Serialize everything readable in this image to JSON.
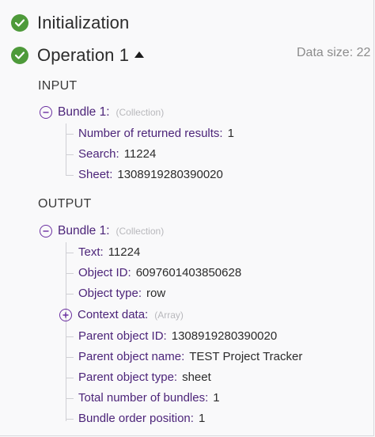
{
  "operations": [
    {
      "title": "Initialization"
    },
    {
      "title": "Operation 1",
      "data_size_label": "Data size: 22"
    }
  ],
  "input": {
    "heading": "INPUT",
    "bundle_label": "Bundle 1:",
    "bundle_type": "(Collection)",
    "fields": [
      {
        "key": "Number of returned results:",
        "value": "1"
      },
      {
        "key": "Search:",
        "value": "11224"
      },
      {
        "key": "Sheet:",
        "value": "1308919280390020"
      }
    ]
  },
  "output": {
    "heading": "OUTPUT",
    "bundle_label": "Bundle 1:",
    "bundle_type": "(Collection)",
    "fields": [
      {
        "key": "Text:",
        "value": "11224"
      },
      {
        "key": "Object ID:",
        "value": "6097601403850628"
      },
      {
        "key": "Object type:",
        "value": "row"
      },
      {
        "key": "Context data:",
        "value": "(Array)"
      },
      {
        "key": "Parent object ID:",
        "value": "1308919280390020"
      },
      {
        "key": "Parent object name:",
        "value": "TEST Project Tracker"
      },
      {
        "key": "Parent object type:",
        "value": "sheet"
      },
      {
        "key": "Total number of bundles:",
        "value": "1"
      },
      {
        "key": "Bundle order position:",
        "value": "1"
      }
    ]
  },
  "colors": {
    "check": "#4e9a3a",
    "key_text": "#4c2479",
    "toggle": "#6b2fa1",
    "muted": "#b8b8bc"
  },
  "icons": {
    "status": "check-circle-icon",
    "collapse": "caret-up-icon",
    "collapse_bundle": "minus-circle-icon",
    "expand_bundle": "plus-circle-icon"
  }
}
